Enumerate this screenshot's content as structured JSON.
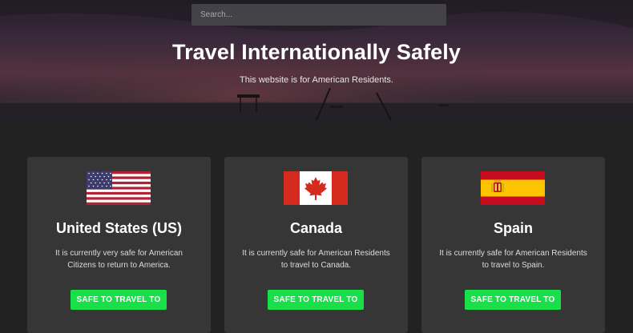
{
  "search": {
    "placeholder": "Search..."
  },
  "hero": {
    "title": "Travel Internationally Safely",
    "subtitle": "This website is for American Residents."
  },
  "cards": [
    {
      "flag_icon": "usa-flag-icon",
      "country": "United States (US)",
      "description": "It is currently very safe for American Citizens to return to America.",
      "button_label": "SAFE TO TRAVEL TO"
    },
    {
      "flag_icon": "canada-flag-icon",
      "country": "Canada",
      "description": "It is currently safe for American Residents to travel to Canada.",
      "button_label": "SAFE TO TRAVEL TO"
    },
    {
      "flag_icon": "spain-flag-icon",
      "country": "Spain",
      "description": "It is currently safe for American Residents to travel to Spain.",
      "button_label": "SAFE TO TRAVEL TO"
    }
  ],
  "colors": {
    "page_background": "#222222",
    "card_background": "#363636",
    "button_green": "#19e04a"
  }
}
